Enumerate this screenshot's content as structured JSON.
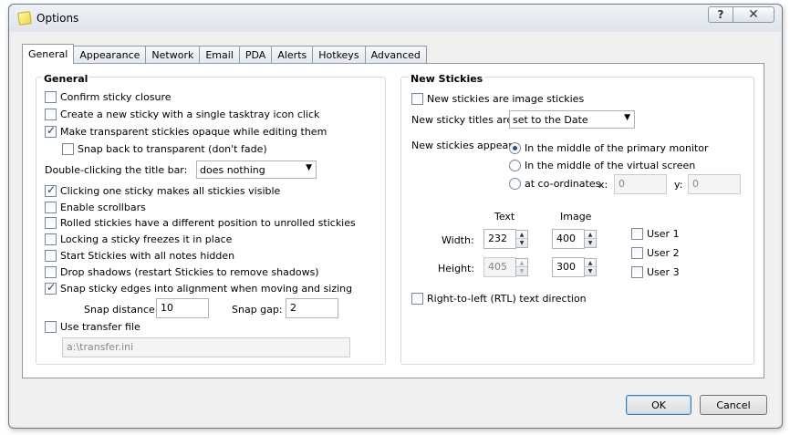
{
  "window": {
    "title": "Options",
    "help_label": "?",
    "close_label": "✕"
  },
  "tabs": [
    {
      "label": "General",
      "active": true
    },
    {
      "label": "Appearance"
    },
    {
      "label": "Network"
    },
    {
      "label": "Email"
    },
    {
      "label": "PDA"
    },
    {
      "label": "Alerts"
    },
    {
      "label": "Hotkeys"
    },
    {
      "label": "Advanced"
    }
  ],
  "general": {
    "title": "General",
    "confirm_closure": {
      "label": "Confirm sticky closure",
      "checked": false
    },
    "single_click_new": {
      "label": "Create a new sticky with a single tasktray icon click",
      "checked": false
    },
    "opaque_editing": {
      "label": "Make transparent stickies opaque while editing them",
      "checked": true
    },
    "snap_back": {
      "label": "Snap back to transparent (don't fade)",
      "checked": false
    },
    "double_click_label": "Double-clicking the title bar:",
    "double_click_value": "does nothing",
    "click_one_visible": {
      "label": "Clicking one sticky makes all stickies visible",
      "checked": true
    },
    "enable_scrollbars": {
      "label": "Enable scrollbars",
      "checked": false
    },
    "rolled_position": {
      "label": "Rolled stickies have a different position to unrolled stickies",
      "checked": false
    },
    "locking_freezes": {
      "label": "Locking a sticky freezes it in place",
      "checked": false
    },
    "start_hidden": {
      "label": "Start Stickies with all notes hidden",
      "checked": false
    },
    "drop_shadows": {
      "label": "Drop shadows (restart Stickies to remove shadows)",
      "checked": false
    },
    "snap_edges": {
      "label": "Snap sticky edges into alignment when moving and sizing",
      "checked": true
    },
    "snap_distance_label": "Snap distance:",
    "snap_distance_value": "10",
    "snap_gap_label": "Snap gap:",
    "snap_gap_value": "2",
    "use_transfer": {
      "label": "Use transfer file",
      "checked": false
    },
    "transfer_path": "a:\\transfer.ini"
  },
  "new_stickies": {
    "title": "New Stickies",
    "image_stickies": {
      "label": "New stickies are image stickies",
      "checked": false
    },
    "titles_label": "New sticky titles are:",
    "titles_value": "set to the Date",
    "appear_label": "New stickies appear:",
    "appear_options": [
      {
        "label": "In the middle of the primary monitor",
        "checked": true
      },
      {
        "label": "In the middle of the virtual screen",
        "checked": false
      },
      {
        "label": "at co-ordinates",
        "checked": false
      }
    ],
    "x_label": "x:",
    "x_value": "0",
    "y_label": "y:",
    "y_value": "0",
    "text_header": "Text",
    "image_header": "Image",
    "width_label": "Width:",
    "width_text": "232",
    "width_image": "400",
    "height_label": "Height:",
    "height_text": "405",
    "height_image": "300",
    "users": [
      {
        "label": "User 1",
        "checked": false
      },
      {
        "label": "User 2",
        "checked": false
      },
      {
        "label": "User 3",
        "checked": false
      }
    ],
    "rtl": {
      "label": "Right-to-left (RTL) text direction",
      "checked": false
    }
  },
  "footer": {
    "ok_label": "OK",
    "cancel_label": "Cancel"
  }
}
